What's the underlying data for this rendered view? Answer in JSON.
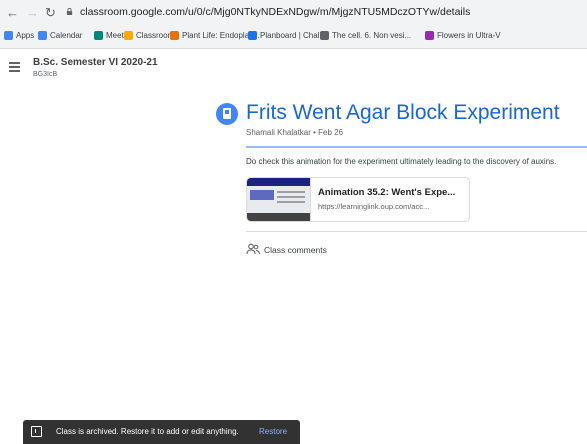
{
  "browser": {
    "url": "classroom.google.com/u/0/c/Mjg0NTkyNDExNDgw/m/MjgzNTU5MDczOTYw/details",
    "bookmarks": [
      {
        "label": "Apps",
        "icon": "apps-grid-icon",
        "color": "#4285f4"
      },
      {
        "label": "Calendar",
        "icon": "calendar-icon",
        "color": "#4285f4"
      },
      {
        "label": "Meet",
        "icon": "meet-icon",
        "color": "#00897b"
      },
      {
        "label": "Classroom",
        "icon": "classroom-icon",
        "color": "#f9ab00"
      },
      {
        "label": "Plant Life: Endoplas...",
        "icon": "bookmark-icon",
        "color": "#e8710a"
      },
      {
        "label": "Planboard | Chalk",
        "icon": "bookmark-icon",
        "color": "#1a73e8"
      },
      {
        "label": "The cell. 6. Non vesi...",
        "icon": "bookmark-icon",
        "color": "#5f6368"
      },
      {
        "label": "Flowers in Ultra-V",
        "icon": "bookmark-icon",
        "color": "#9c27b0"
      }
    ]
  },
  "course": {
    "title": "B.Sc. Semester VI 2020-21",
    "section": "BG3IcB"
  },
  "post": {
    "title": "Frits Went Agar Block Experiment",
    "meta": "Shamali Khalatkar • Feb 26",
    "body": "Do check this animation for the experiment ultimately leading to the discovery of auxins.",
    "attachment": {
      "title": "Animation 35.2: Went's Expe...",
      "url": "https://learninglink.oup.com/acc..."
    },
    "comments_label": "Class comments"
  },
  "snackbar": {
    "message": "Class is archived. Restore it to add or edit anything.",
    "action": "Restore"
  },
  "colors": {
    "accent": "#1967d2",
    "icon_blue": "#4285f4"
  }
}
